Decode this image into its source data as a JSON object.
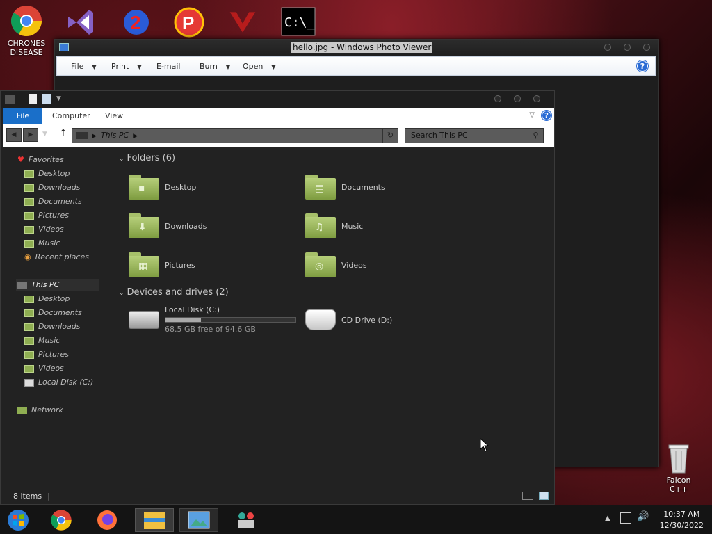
{
  "desktop": {
    "icons": [
      {
        "label": "CHRONES DISEASE"
      },
      {
        "label": "Falcon C++"
      }
    ]
  },
  "photo_viewer": {
    "title": "hello.jpg - Windows Photo Viewer",
    "menu": [
      {
        "label": "File"
      },
      {
        "label": "Print"
      },
      {
        "label": "E-mail"
      },
      {
        "label": "Burn"
      },
      {
        "label": "Open"
      }
    ]
  },
  "explorer": {
    "ribbon": {
      "file": "File",
      "computer": "Computer",
      "view": "View"
    },
    "address": "This PC",
    "search_placeholder": "Search This PC",
    "sidebar": {
      "favorites": {
        "label": "Favorites",
        "items": [
          "Desktop",
          "Downloads",
          "Documents",
          "Pictures",
          "Videos",
          "Music",
          "Recent places"
        ]
      },
      "thispc": {
        "label": "This PC",
        "items": [
          "Desktop",
          "Documents",
          "Downloads",
          "Music",
          "Pictures",
          "Videos",
          "Local Disk (C:)"
        ]
      },
      "network": "Network"
    },
    "folders_header": "Folders (6)",
    "folders": [
      "Desktop",
      "Documents",
      "Downloads",
      "Music",
      "Pictures",
      "Videos"
    ],
    "drives_header": "Devices and drives (2)",
    "drives": [
      {
        "name": "Local Disk (C:)",
        "free": "68.5 GB free of 94.6 GB",
        "used_fraction": 0.276
      },
      {
        "name": "CD Drive (D:)"
      }
    ],
    "status": "8 items"
  },
  "taskbar": {
    "time": "10:37 AM",
    "date": "12/30/2022"
  },
  "colors": {
    "accent": "#1a6fc9",
    "folder": "#8fae52"
  }
}
